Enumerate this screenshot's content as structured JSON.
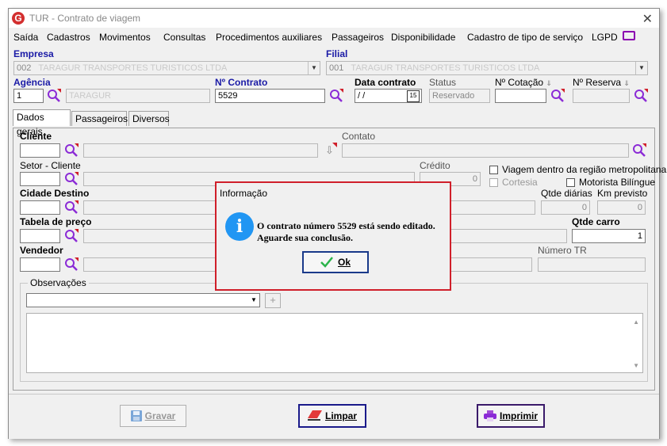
{
  "window": {
    "title": "TUR - Contrato de viagem",
    "close": "✕"
  },
  "menu": [
    "Saída",
    "Cadastros",
    "Movimentos",
    "Consultas",
    "Procedimentos auxiliares",
    "Passageiros",
    "Disponibilidade",
    "Cadastro de tipo de serviço",
    "LGPD"
  ],
  "header": {
    "empresa_label": "Empresa",
    "empresa_value": "002",
    "empresa_blurred": "TARAGUR TRANSPORTES TURISTICOS LTDA",
    "filial_label": "Filial",
    "filial_value": "001",
    "filial_blurred": "TARAGUR TRANSPORTES TURISTICOS LTDA",
    "agencia_label": "Agência",
    "agencia_value": "1",
    "agencia_blurred": "TARAGUR",
    "contrato_label": "Nº Contrato",
    "contrato_value": "5529",
    "data_label": "Data contrato",
    "data_value": " / /",
    "calendar_day": "15",
    "status_label": "Status",
    "status_value": "Reservado",
    "cotacao_label": "Nº Cotação",
    "reserva_label": "Nº Reserva"
  },
  "tabs": [
    "Dados gerais",
    "Passageiros",
    "Diversos"
  ],
  "form": {
    "cliente_label": "Cliente",
    "contato_label": "Contato",
    "setor_label": "Setor - Cliente",
    "credito_label": "Crédito",
    "credito_value": "0",
    "viagem_metro_label": "Viagem dentro da região metropolitana",
    "cortesia_label": "Cortesia",
    "motorista_label": "Motorista Bilíngue",
    "cidade_label": "Cidade Destino",
    "qtde_diarias_label": "Qtde diárias",
    "qtde_diarias_value": "0",
    "km_label": "Km previsto",
    "km_value": "0",
    "tabela_label": "Tabela de preço",
    "qtde_carro_label": "Qtde carro",
    "qtde_carro_value": "1",
    "vendedor_label": "Vendedor",
    "numero_tr_label": "Número TR",
    "observacoes_label": "Observações"
  },
  "buttons": {
    "gravar": "Gravar",
    "limpar": "Limpar",
    "imprimir": "Imprimir"
  },
  "dialog": {
    "title": "Informação",
    "line1": "O contrato número 5529 está sendo editado.",
    "line2": "Aguarde sua conclusão.",
    "ok": "Ok",
    "icon": "i"
  },
  "colors": {
    "accent_red": "#d01f2a",
    "label_blue": "#1a1aa6",
    "search_purple": "#8b2bd6",
    "info_blue": "#2196f3"
  }
}
